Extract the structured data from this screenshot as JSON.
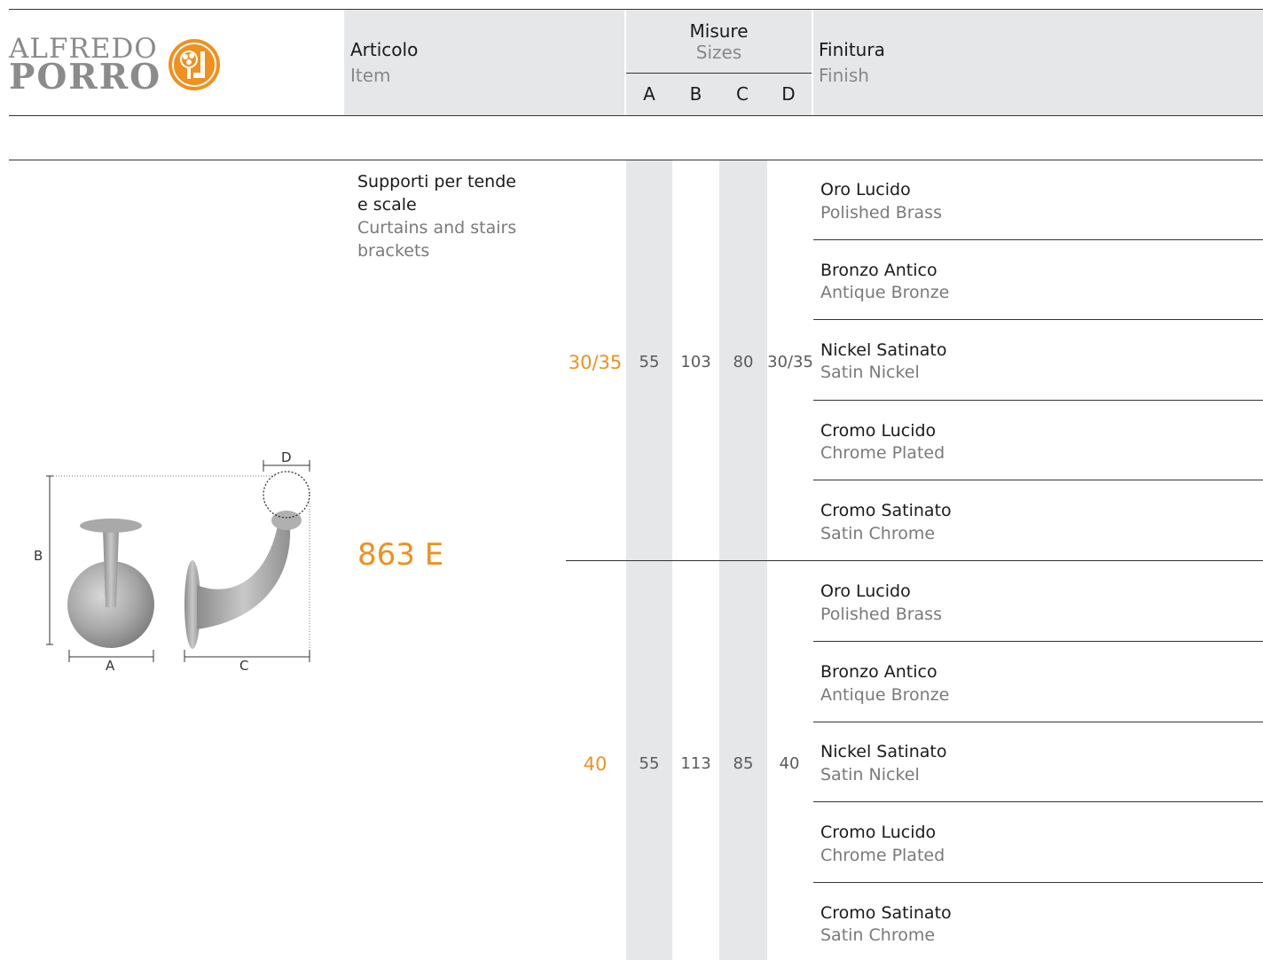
{
  "logo": {
    "line1": "ALFREDO",
    "line2": "PORRO"
  },
  "header": {
    "item_it": "Articolo",
    "item_en": "Item",
    "sizes_it": "Misure",
    "sizes_en": "Sizes",
    "cols": [
      "A",
      "B",
      "C",
      "D"
    ],
    "finish_it": "Finitura",
    "finish_en": "Finish"
  },
  "product": {
    "desc_it_1": "Supporti per tende",
    "desc_it_2": "e scale",
    "desc_en_1": "Curtains and stairs",
    "desc_en_2": "brackets",
    "code": "863 E"
  },
  "drawing": {
    "label_a": "A",
    "label_b": "B",
    "label_c": "C",
    "label_d": "D"
  },
  "variants": [
    {
      "diameter": "30/35",
      "a": "55",
      "b": "103",
      "c": "80",
      "d": "30/35"
    },
    {
      "diameter": "40",
      "a": "55",
      "b": "113",
      "c": "85",
      "d": "40"
    }
  ],
  "finishes": [
    {
      "it": "Oro Lucido",
      "en": "Polished Brass"
    },
    {
      "it": "Bronzo Antico",
      "en": "Antique Bronze"
    },
    {
      "it": "Nickel Satinato",
      "en": "Satin Nickel"
    },
    {
      "it": "Cromo Lucido",
      "en": "Chrome Plated"
    },
    {
      "it": "Cromo Satinato",
      "en": "Satin Chrome"
    },
    {
      "it": "Oro Lucido",
      "en": "Polished Brass"
    },
    {
      "it": "Bronzo Antico",
      "en": "Antique Bronze"
    },
    {
      "it": "Nickel Satinato",
      "en": "Satin Nickel"
    },
    {
      "it": "Cromo Lucido",
      "en": "Chrome Plated"
    },
    {
      "it": "Cromo Satinato",
      "en": "Satin Chrome"
    }
  ],
  "colors": {
    "accent": "#f0901e",
    "header_bg": "#e6e7e8",
    "logo_grey": "#8b8b8b"
  }
}
